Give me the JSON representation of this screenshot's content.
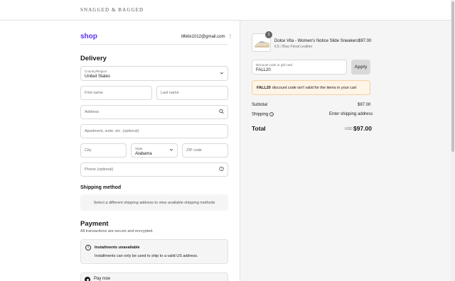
{
  "header": {
    "brand": "SNAGGED & BAGGED"
  },
  "account": {
    "shop_logo": "shop",
    "email": "lilfelix1012@gmail.com",
    "menu_icon": "kebab-icon"
  },
  "delivery": {
    "heading": "Delivery",
    "country": {
      "label": "Country/Region",
      "value": "United States"
    },
    "first_name": {
      "placeholder": "First name"
    },
    "last_name": {
      "placeholder": "Last name"
    },
    "address": {
      "placeholder": "Address"
    },
    "apartment": {
      "placeholder": "Apartment, suite, etc. (optional)"
    },
    "city": {
      "placeholder": "City"
    },
    "state": {
      "label": "State",
      "value": "Alabama"
    },
    "zip": {
      "placeholder": "ZIP code"
    },
    "phone": {
      "placeholder": "Phone (optional)"
    }
  },
  "shipping": {
    "heading": "Shipping method",
    "notice": "Select a different shipping address to view available shipping methods"
  },
  "payment": {
    "heading": "Payment",
    "subtitle": "All transactions are secure and encrypted.",
    "installments_title": "Installments unavailable",
    "installments_body": "Installments can only be used to ship to a valid US address.",
    "pay_now": "Pay now"
  },
  "cart": {
    "item": {
      "quantity": "1",
      "name": "Dolce Vita - Women's Notice Slide Sneakers",
      "variant": "6.5 / Blue Floral Leather",
      "price": "$97.00"
    },
    "discount": {
      "label": "Discount code or gift card",
      "value": "FALL20",
      "apply": "Apply"
    },
    "error": {
      "code": "FALL20",
      "message": "discount code isn't valid for the items in your cart"
    },
    "subtotal_label": "Subtotal",
    "subtotal_value": "$97.00",
    "shipping_label": "Shipping",
    "shipping_value": "Enter shipping address",
    "total_label": "Total",
    "currency": "USD",
    "total_value": "$97.00"
  }
}
